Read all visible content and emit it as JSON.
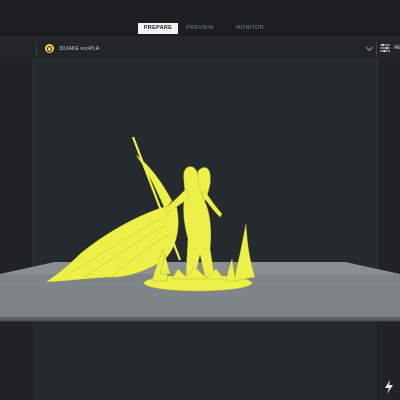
{
  "tabs": [
    "PREPARE",
    "PREVIEW",
    "MONITOR"
  ],
  "toolbar": {
    "material_label": "3DJAKE ecoPLA",
    "settings_label": "AE"
  },
  "icons": {
    "material": "filament-spool-icon",
    "dropdown": "chevron-down-icon",
    "settings": "sliders-icon",
    "action": "lightning-bolt-icon"
  },
  "colors": {
    "model": "#eef04a",
    "build_plate": "#7f8488",
    "background": "#252a2e",
    "topbar": "#1b1f22"
  }
}
